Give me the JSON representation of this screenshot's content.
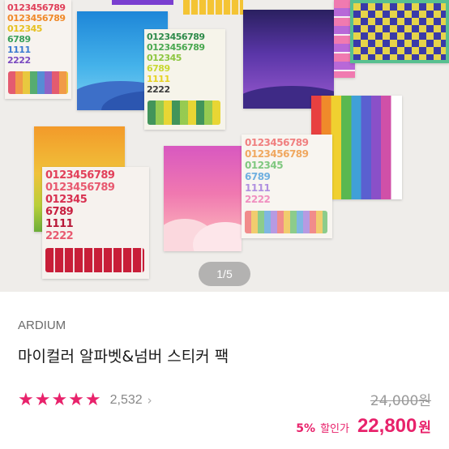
{
  "gallery": {
    "counter": "1/5",
    "sheet_numbers": [
      "0123456789",
      "0123456789",
      "012345",
      "6789",
      "1111",
      "2222"
    ]
  },
  "product": {
    "brand": "ARDIUM",
    "title": "마이컬러 알파벳&넘버 스티커 팩",
    "rating_stars": "★★★★★",
    "rating_value": 5,
    "review_count": "2,532",
    "original_price": "24,000원",
    "discount_percent": "5%",
    "discount_label": "할인가",
    "price": "22,800",
    "currency": "원"
  },
  "colors": {
    "accent": "#e8226b",
    "muted_text": "#888888"
  }
}
